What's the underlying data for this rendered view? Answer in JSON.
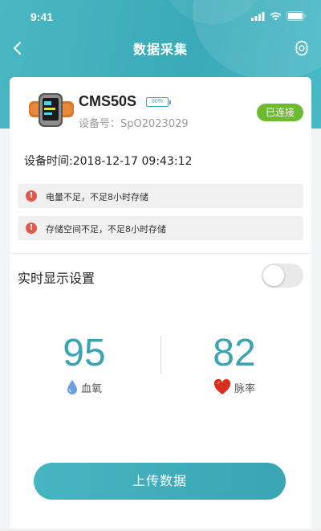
{
  "status_bar": {
    "time": "9:41"
  },
  "nav": {
    "title": "数据采集"
  },
  "device": {
    "name": "CMS50S",
    "battery": "80%",
    "id_label": "设备号：SpO2023029",
    "connection_status": "已连接",
    "time_text": "设备时间:2018-12-17 09:43:12"
  },
  "alerts": [
    {
      "text": "电量不足，不足8小时存储"
    },
    {
      "text": "存储空间不足，不足8小时存储"
    }
  ],
  "realtime": {
    "label": "实时显示设置",
    "enabled": false
  },
  "metrics": {
    "spo2": {
      "value": "95",
      "label": "血氧"
    },
    "pulse": {
      "value": "82",
      "label": "脉率"
    }
  },
  "upload_button": {
    "label": "上传数据"
  },
  "colors": {
    "accent": "#3aa8b6",
    "connected": "#6dbb30",
    "alert": "#e05a4e",
    "heart": "#d92f1e",
    "drop": "#6a9fe0"
  }
}
